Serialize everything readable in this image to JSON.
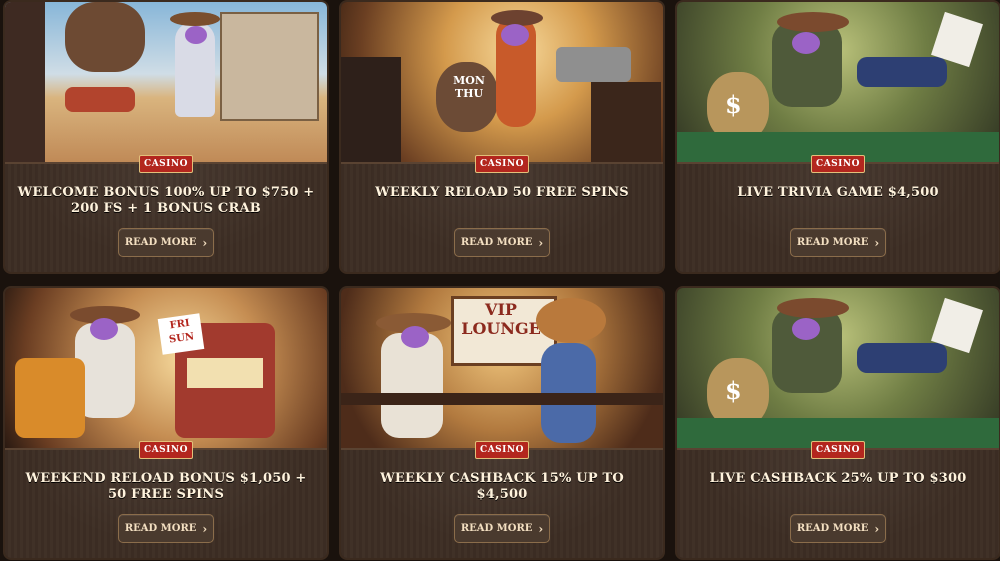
{
  "cards": [
    {
      "badge": "CASINO",
      "title": "WELCOME BONUS 100% UP TO $750 + 200 FS + 1 BONUS CRAB",
      "button": "READ MORE",
      "chevron": "chevron-right-icon"
    },
    {
      "badge": "CASINO",
      "title": "WEEKLY RELOAD 50 FREE SPINS",
      "button": "READ MORE",
      "chevron": "chevron-right-icon",
      "sack_text": "MON THU"
    },
    {
      "badge": "CASINO",
      "title": "LIVE TRIVIA GAME $4,500",
      "button": "READ MORE",
      "chevron": "chevron-right-icon"
    },
    {
      "badge": "CASINO",
      "title": "WEEKEND RELOAD BONUS $1,050 + 50 FREE SPINS",
      "button": "READ MORE",
      "chevron": "chevron-right-icon",
      "sign_text": "FRI SUN"
    },
    {
      "badge": "CASINO",
      "title": "WEEKLY CASHBACK 15% UP TO $4,500",
      "button": "READ MORE",
      "chevron": "chevron-right-icon",
      "sign_text": "VIP LOUNGE"
    },
    {
      "badge": "CASINO",
      "title": "LIVE CASHBACK 25% UP TO $300",
      "button": "READ MORE",
      "chevron": "chevron-right-icon"
    }
  ]
}
